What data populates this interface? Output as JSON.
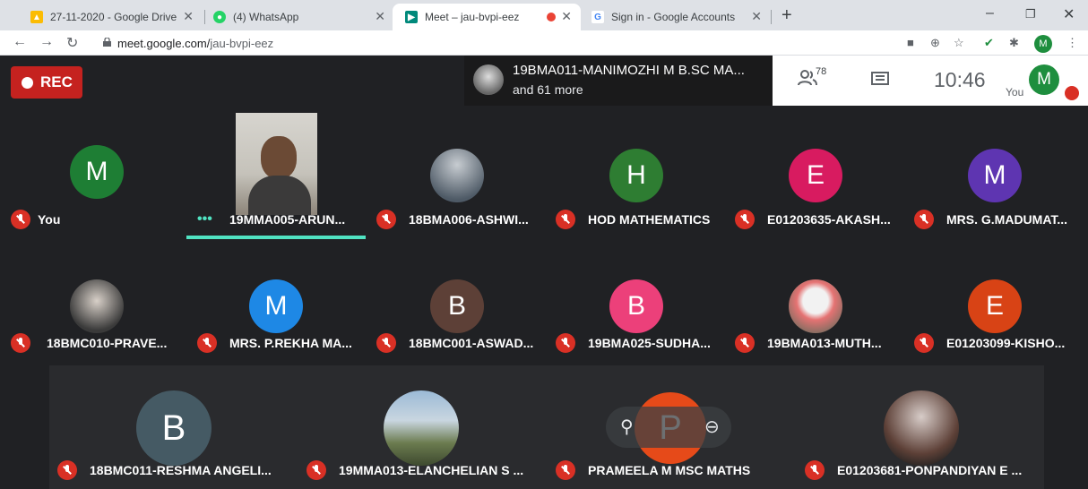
{
  "browser": {
    "tabs": [
      {
        "title": "27-11-2020 - Google Drive",
        "favicon": "google-drive-icon",
        "color": "#fbbc04"
      },
      {
        "title": "(4) WhatsApp",
        "favicon": "whatsapp-icon",
        "color": "#25d366"
      },
      {
        "title": "Meet – jau-bvpi-eez",
        "favicon": "meet-icon",
        "color": "#00897b"
      },
      {
        "title": "Sign in - Google Accounts",
        "favicon": "google-icon",
        "color": "#4285f4"
      }
    ],
    "url_host": "meet.google.com/",
    "url_path": "jau-bvpi-eez",
    "profile_initial": "M"
  },
  "meet": {
    "rec_label": "REC",
    "presenter_line1": "19BMA011-MANIMOZHI M B.SC MA...",
    "presenter_line2": "and 61 more",
    "people_count": "78",
    "clock": "10:46",
    "you_label": "You",
    "self_initial": "M",
    "tiles": [
      {
        "name": "You",
        "initial": "M",
        "color": "#1e7e34"
      },
      {
        "name": "19MMA005-ARUN...",
        "initial": "",
        "color": ""
      },
      {
        "name": "18BMA006-ASHWI...",
        "initial": "",
        "color": "#555"
      },
      {
        "name": "HOD MATHEMATICS",
        "initial": "H",
        "color": "#2e7d32"
      },
      {
        "name": "E01203635-AKASH...",
        "initial": "E",
        "color": "#d81b60"
      },
      {
        "name": "MRS. G.MADUMAT...",
        "initial": "M",
        "color": "#5e35b1"
      },
      {
        "name": "18BMC010-PRAVE...",
        "initial": "",
        "color": "#444"
      },
      {
        "name": "MRS. P.REKHA MA...",
        "initial": "M",
        "color": "#1e88e5"
      },
      {
        "name": "18BMC001-ASWAD...",
        "initial": "B",
        "color": "#5d4037"
      },
      {
        "name": "19BMA025-SUDHA...",
        "initial": "B",
        "color": "#ec407a"
      },
      {
        "name": "19BMA013-MUTH...",
        "initial": "",
        "color": "#b0bec5"
      },
      {
        "name": "E01203099-KISHO...",
        "initial": "E",
        "color": "#d84315"
      },
      {
        "name": "18BMC011-RESHMA ANGELI...",
        "initial": "B",
        "color": "#455a64"
      },
      {
        "name": "19MMA013-ELANCHELIAN S ...",
        "initial": "",
        "color": "#7a8a6a"
      },
      {
        "name": "PRAMEELA M MSC MATHS",
        "initial": "P",
        "color": "#e64a19"
      },
      {
        "name": "E01203681-PONPANDIYAN E ...",
        "initial": "",
        "color": "#555"
      }
    ]
  }
}
